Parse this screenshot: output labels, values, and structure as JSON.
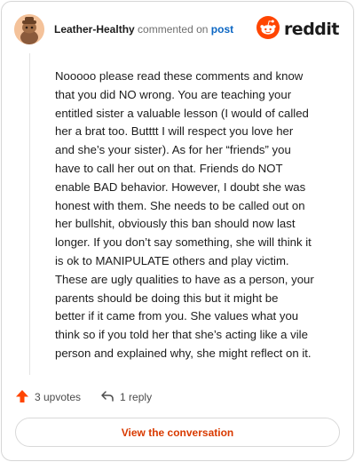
{
  "header": {
    "username": "Leather-Healthy",
    "commented_on": "commented on",
    "post_link": "post",
    "brand": "reddit"
  },
  "comment": {
    "text": "Nooooo please read these comments and know\nthat you did NO wrong. You are teaching your\nentitled sister a valuable lesson (I would of called\nher a brat too. Butttt I will respect you love her\nand she’s your sister). As for her “friends” you\nhave to call her out on that. Friends do NOT\nenable BAD behavior. However, I doubt she was\nhonest with them. She needs to be called out on\nher bullshit, obviously this ban should now last\nlonger. If you don’t say something, she will think it\nis ok to MANIPULATE others and play victim.\nThese are ugly qualities to have as a person, your\nparents should be doing this but it might be\nbetter if it came from you. She values what you\nthink so if you told her that she’s acting like a vile\nperson and explained why, she might reflect on it."
  },
  "actions": {
    "upvotes_label": "3 upvotes",
    "replies_label": "1 reply"
  },
  "footer": {
    "view_conversation_label": "View the conversation"
  },
  "icons": {
    "avatar": "snoo-avatar-icon",
    "brand": "reddit-logo-icon",
    "upvote": "upvote-arrow-icon",
    "reply": "reply-arrow-icon"
  },
  "colors": {
    "brand_orange": "#ff4500",
    "link_blue": "#0b66c3",
    "cta_text": "#d93a00",
    "upvote_orange": "#ff4500"
  }
}
